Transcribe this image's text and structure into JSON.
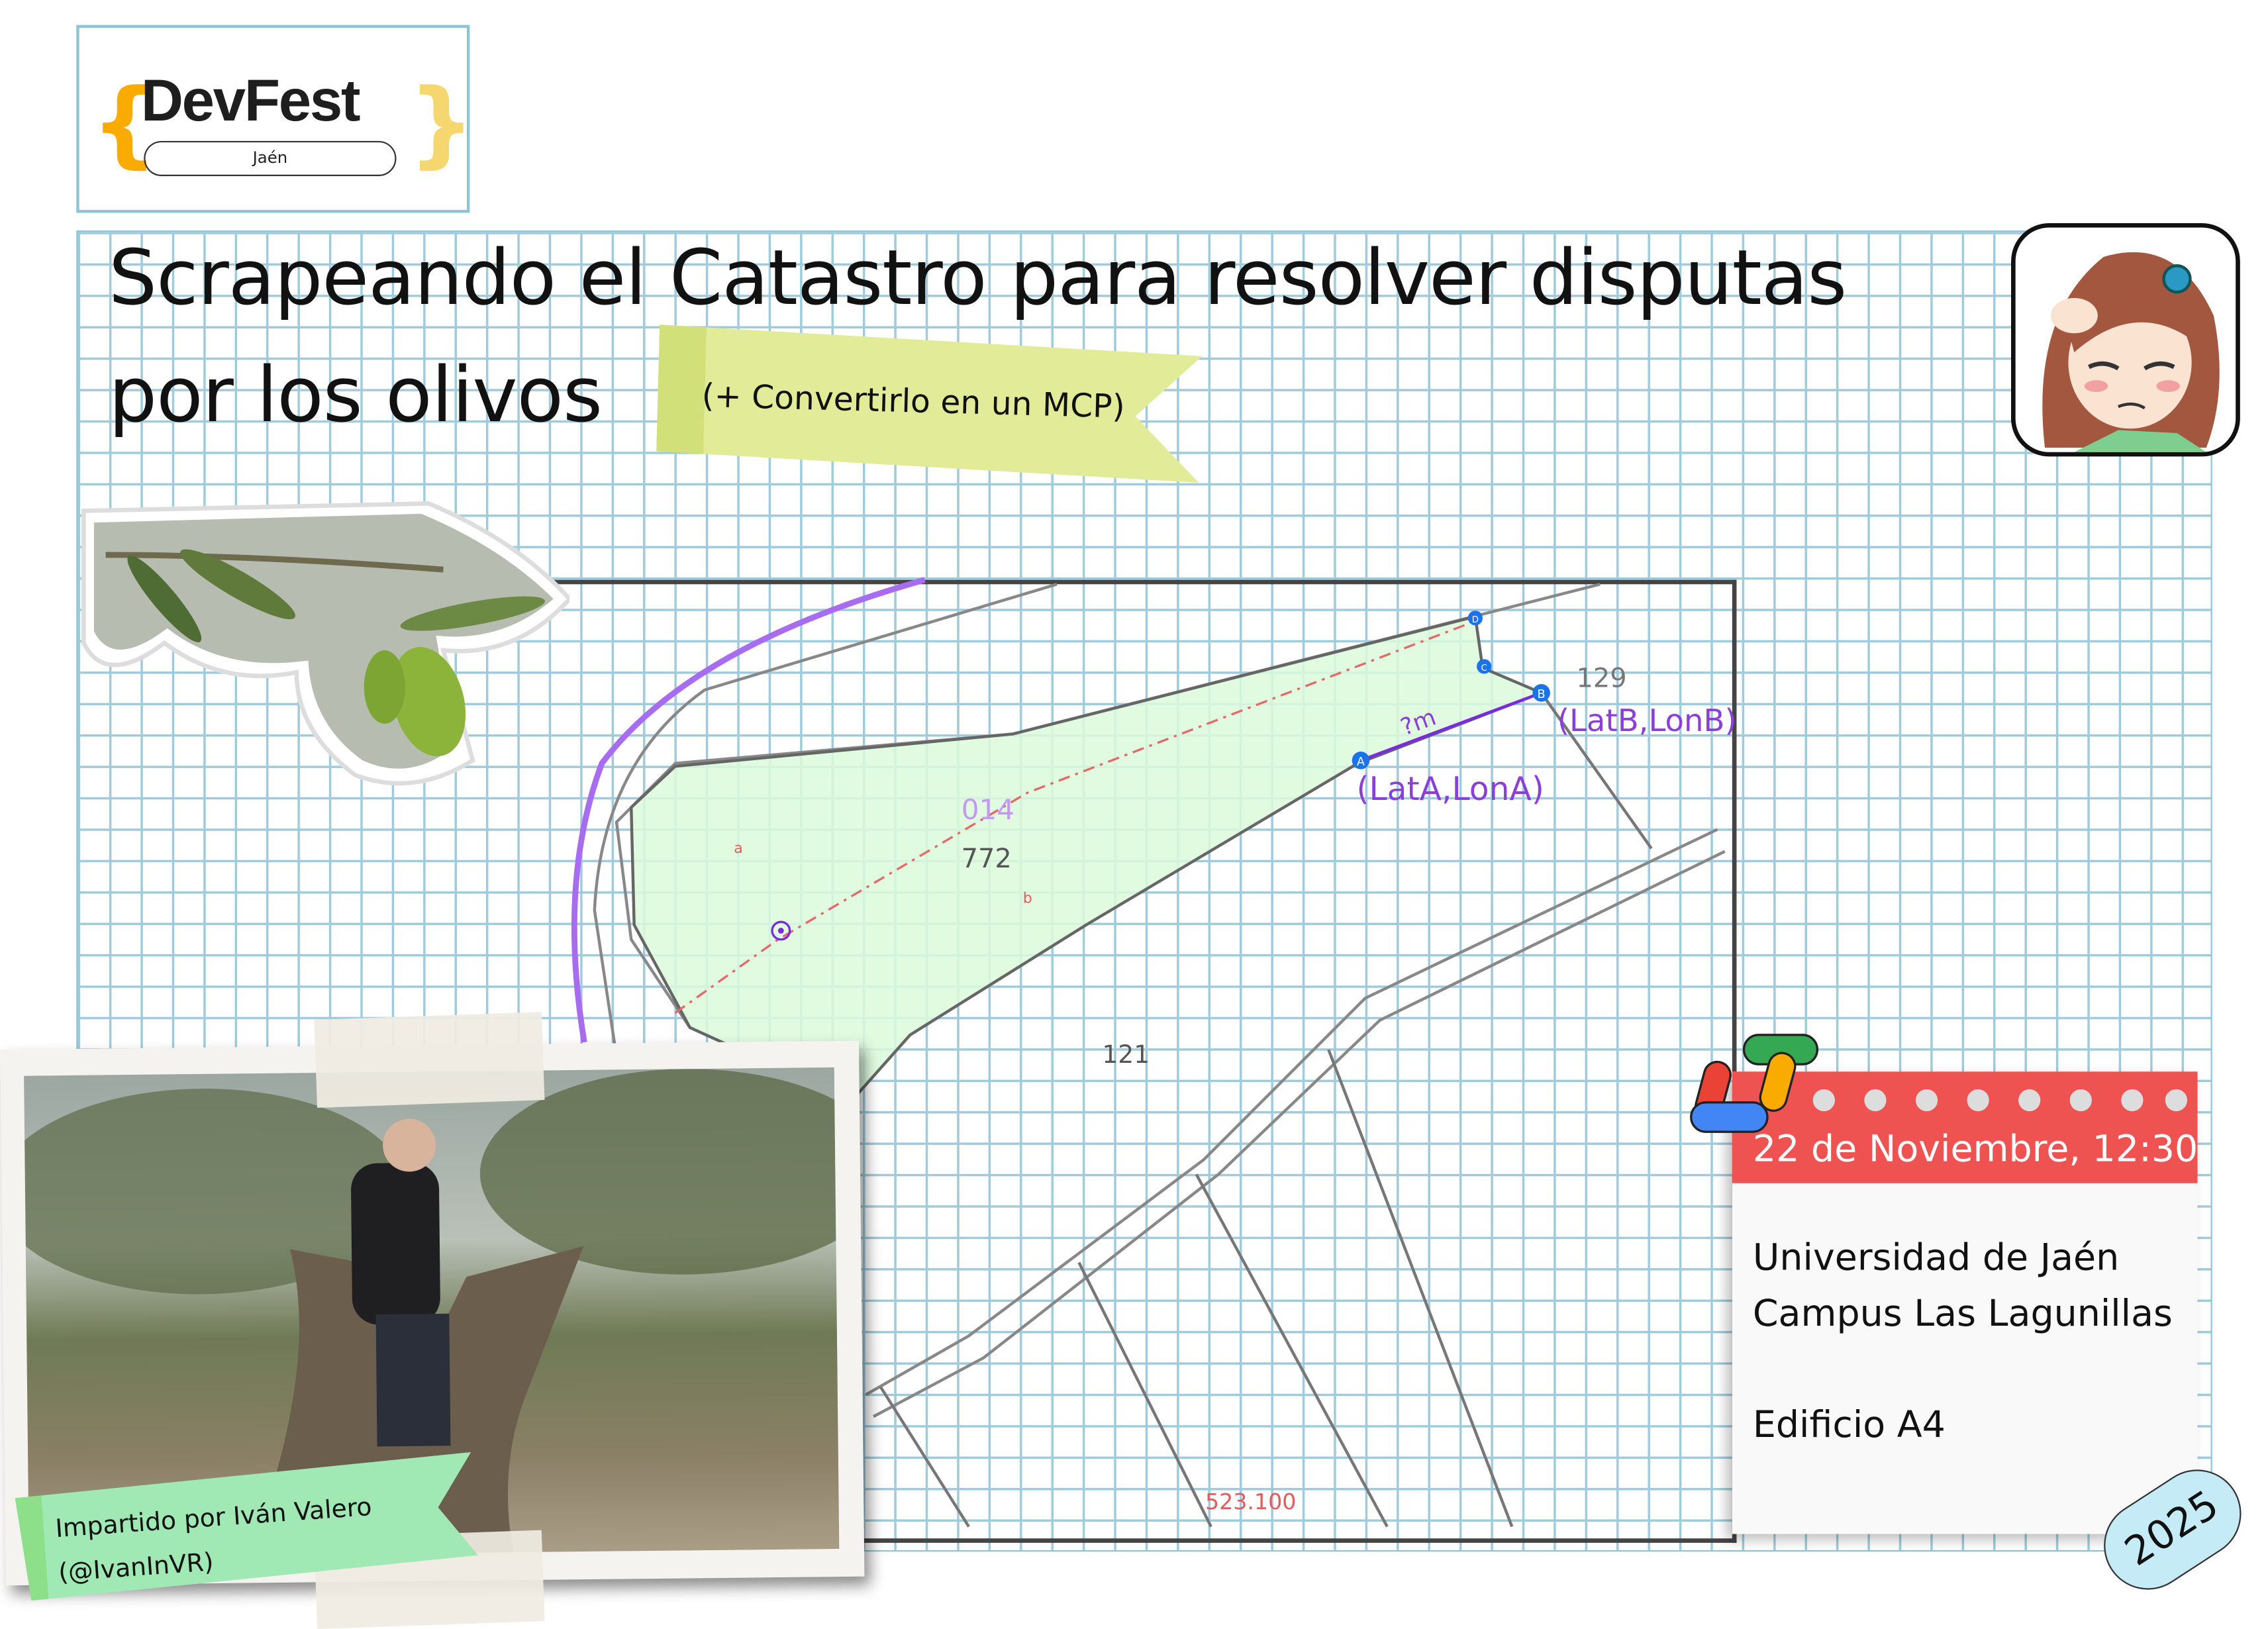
{
  "logo": {
    "name": "DevFest",
    "location": "Jaén",
    "brace_left_color": "#f9ab00",
    "brace_right_color": "#fde293"
  },
  "title": {
    "line1": "Scrapeando el Catastro para resolver disputas",
    "line2": "por los olivos"
  },
  "subtitle_banner": "(+ Convertirlo en un MCP)",
  "map": {
    "parcel_labels": [
      "014",
      "772",
      "129",
      "121"
    ],
    "small_labels": [
      "a",
      "b"
    ],
    "coordinate_label": "523.100",
    "points": [
      "A",
      "B",
      "C",
      "D"
    ],
    "distance_label": "?m",
    "point_a_annotation": "(LatA,LonA)",
    "point_b_annotation": "(LatB,LonB)",
    "parcel_fill": "#dcfadc",
    "annotation_color": "#8a3fd9",
    "point_color": "#1a73e8"
  },
  "speaker": {
    "line1": "Impartido por Iván Valero",
    "line2": "(@IvanInVR)"
  },
  "event": {
    "date": "22 de Noviembre, 12:30",
    "venue_line1": "Universidad de Jaén",
    "venue_line2": "Campus Las Lagunillas",
    "building": "Edificio A4",
    "year": "2025",
    "header_color": "#ee5352"
  }
}
